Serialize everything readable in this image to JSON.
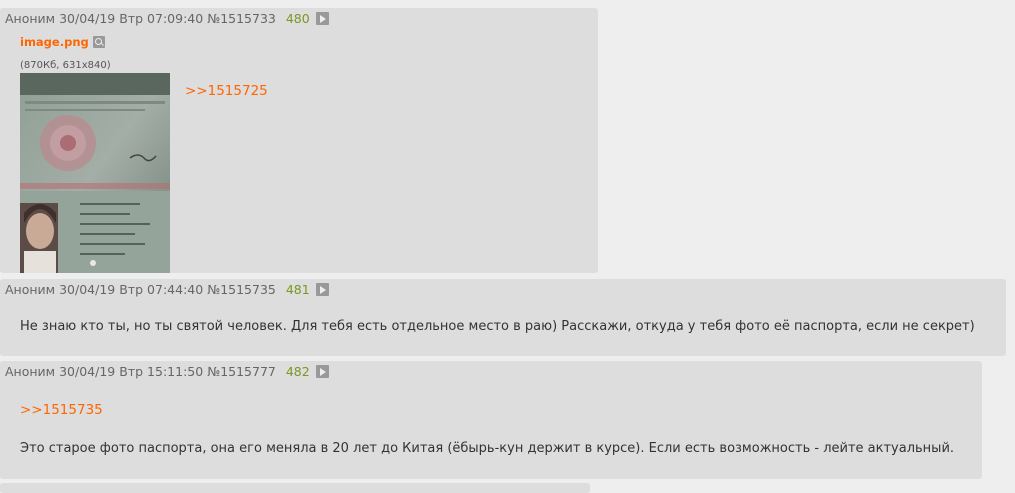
{
  "posts": [
    {
      "author": "Аноним",
      "date": "30/04/19",
      "weekday": "Втр",
      "time": "07:09:40",
      "post_id": "№1515733",
      "reply_number": "480",
      "file": {
        "name": "image.png",
        "meta": "(870Кб, 631x840)"
      },
      "reply_link": ">>1515725"
    },
    {
      "author": "Аноним",
      "date": "30/04/19",
      "weekday": "Втр",
      "time": "07:44:40",
      "post_id": "№1515735",
      "reply_number": "481",
      "text": "Не знаю кто ты, но ты святой человек. Для тебя есть отдельное место в раю) Расскажи, откуда у тебя фото её паспорта, если не секрет)"
    },
    {
      "author": "Аноним",
      "date": "30/04/19",
      "weekday": "Втр",
      "time": "15:11:50",
      "post_id": "№1515777",
      "reply_number": "482",
      "reply_link": ">>1515735",
      "text": "Это старое фото паспорта, она его меняла в 20 лет до Китая (ёбырь-кун держит в курсе). Если есть возможность - лейте актуальный."
    }
  ],
  "colors": {
    "page_bg": "#eeeeee",
    "post_bg": "#dddddd",
    "header_text": "#666666",
    "reply_number": "#789922",
    "link": "#ff6600",
    "body_text": "#333333"
  }
}
